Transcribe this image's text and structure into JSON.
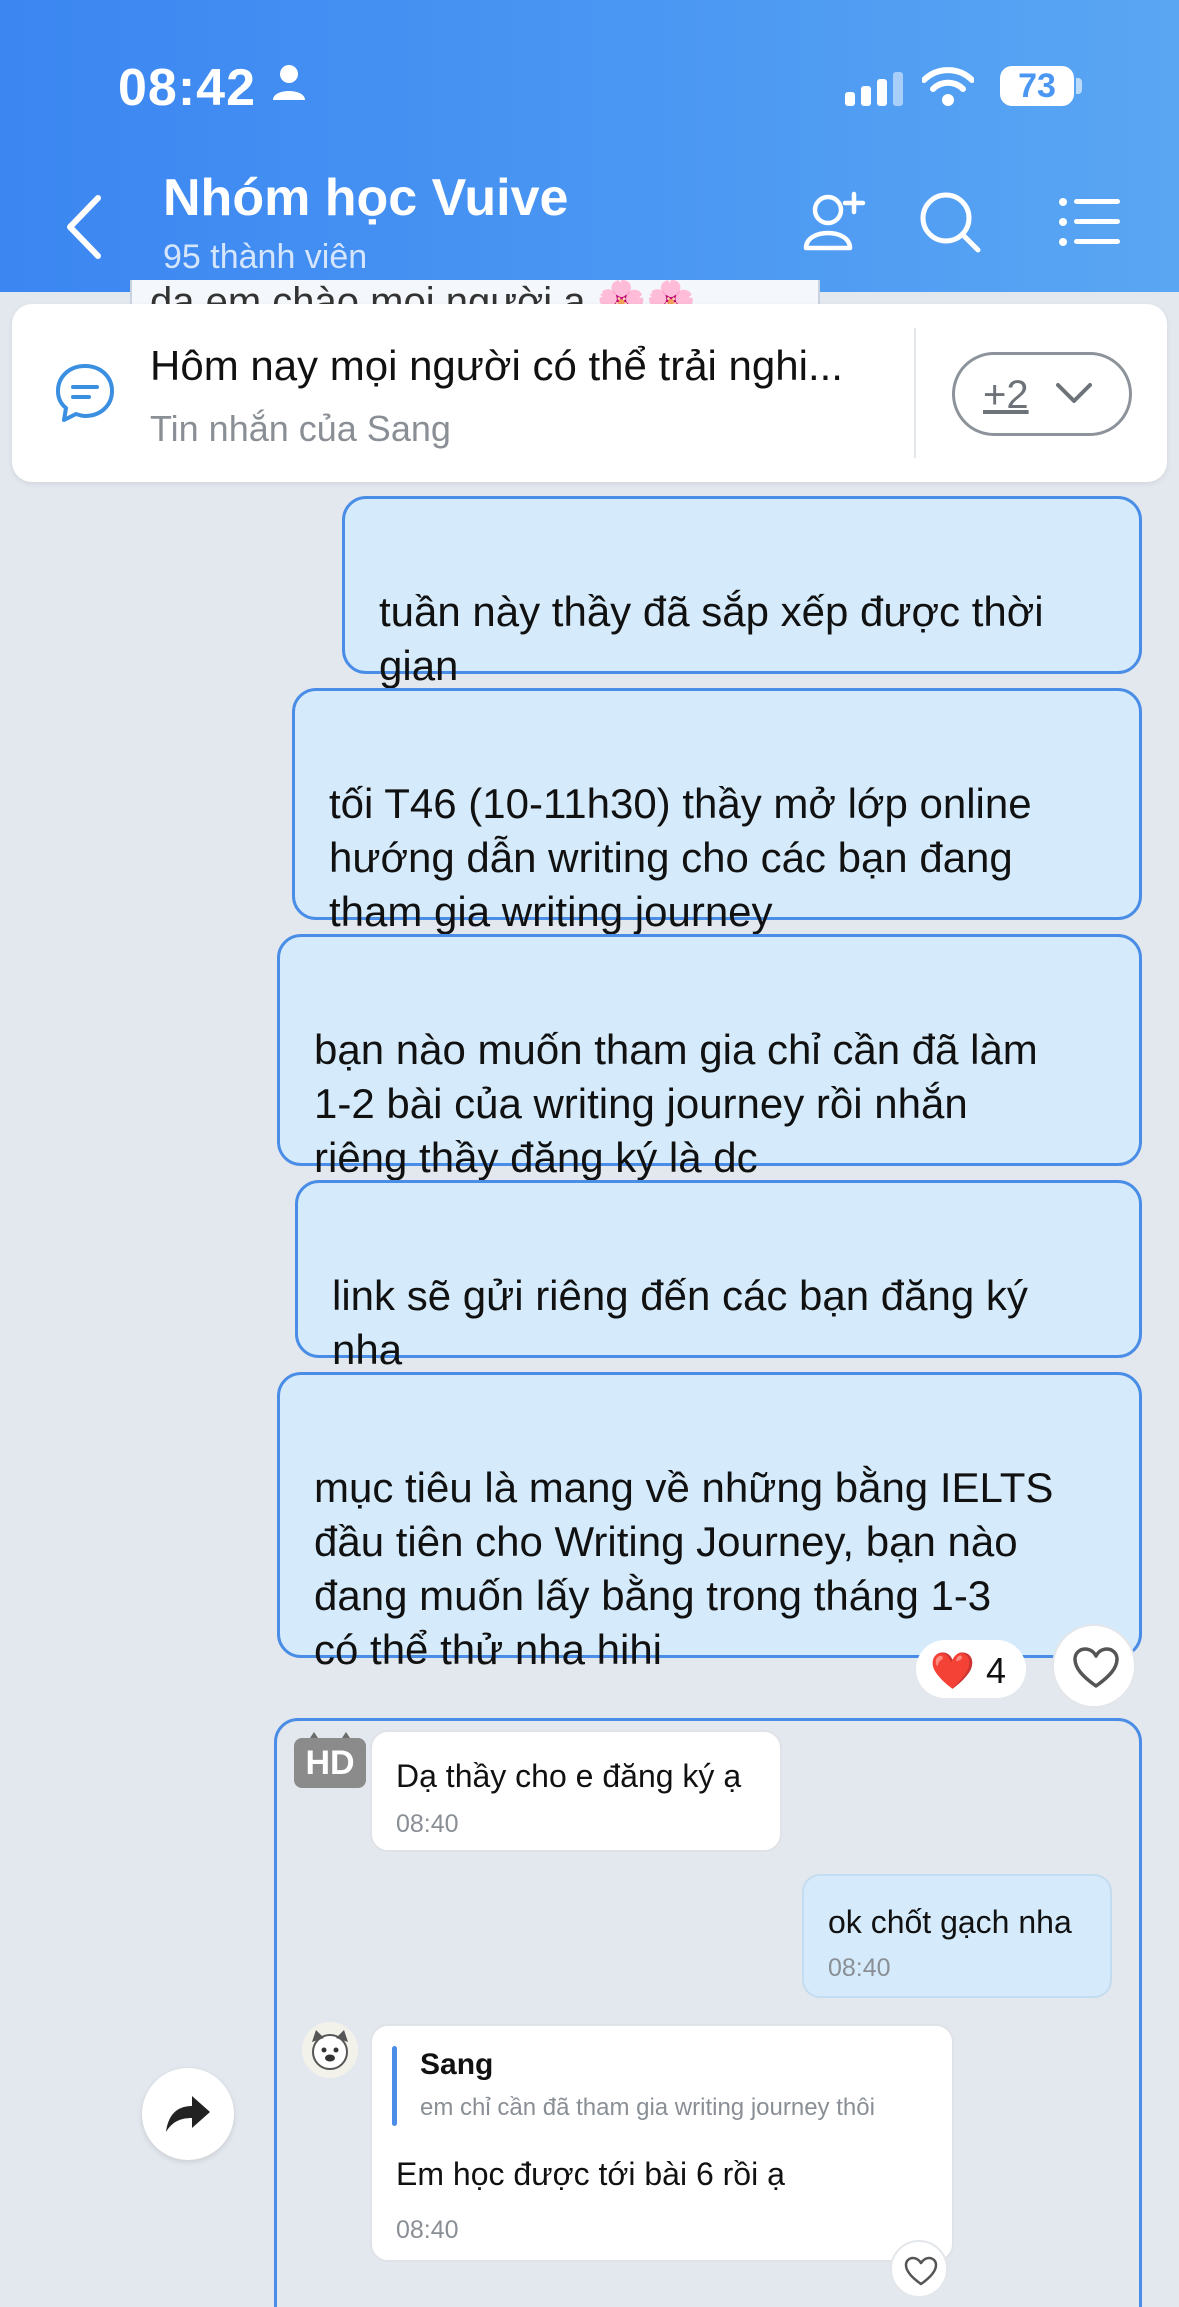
{
  "status_bar": {
    "time": "08:42",
    "battery": "73"
  },
  "header": {
    "title": "Nhóm học Vuive",
    "members": "95 thành viên"
  },
  "pinned": {
    "peek_text": "dạ em chào mọi người ạ 🌸🌸",
    "text": "Hôm nay mọi người có thể trải nghi...",
    "sender": "Tin nhắn của Sang",
    "more_label": "+2"
  },
  "messages": [
    {
      "text": "tuần này thầy đã sắp xếp được thời\ngian"
    },
    {
      "text": "tối T46 (10-11h30) thầy mở lớp online\nhướng dẫn writing cho các bạn đang\ntham gia writing journey"
    },
    {
      "text": "bạn nào muốn tham gia chỉ cần đã làm\n1-2 bài của writing journey rồi nhắn\nriêng thầy đăng ký là dc"
    },
    {
      "text": "link sẽ gửi riêng đến các bạn đăng ký\nnha"
    },
    {
      "text": "mục tiêu là mang về những bằng IELTS\nđầu tiên cho Writing Journey, bạn nào\nđang muốn lấy bằng trong tháng 1-3\ncó thể thử nha hihi"
    }
  ],
  "reaction": {
    "emoji": "❤️",
    "count": "4"
  },
  "thread": {
    "avatar_label": "HD",
    "reply1": {
      "text": "Dạ thầy cho e đăng ký ạ",
      "time": "08:40"
    },
    "reply2": {
      "text": "ok chốt gạch nha",
      "time": "08:40"
    },
    "reply3": {
      "quote_name": "Sang",
      "quote_text": "em chỉ cần đã tham gia writing journey thôi",
      "text": "Em học được tới bài 6 rồi ạ",
      "time": "08:40"
    }
  },
  "colors": {
    "header": "#3b86f1",
    "bubble_out": "#d5ebfb",
    "accent": "#4a8de6",
    "background": "#e3e8ef"
  }
}
